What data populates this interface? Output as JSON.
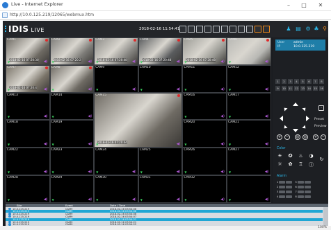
{
  "window": {
    "title": "Live - Internet Explorer",
    "url": "http://10.0.125.219/12065/webmux.htm",
    "minimize": "–",
    "restore": "□",
    "close": "✕"
  },
  "app": {
    "logo": "IDIS",
    "mode": "LIVE",
    "datetime": "2018-02-16 11:54:41"
  },
  "cameras": [
    "CAM1",
    "CAM2",
    "CAM3",
    "CAM4",
    "CAM5",
    "CAM6",
    "CAM7",
    "CAM8",
    "CAM9",
    "CAM10",
    "CAM11",
    "CAM12",
    "CAM13",
    "CAM14",
    "CAM15",
    "CAM16",
    "CAM17",
    "CAM18",
    "CAM19",
    "CAM20",
    "CAM21",
    "CAM22",
    "CAM23",
    "CAM24",
    "CAM25",
    "CAM26",
    "CAM27",
    "CAM28",
    "CAM29",
    "CAM30",
    "CAM31",
    "CAM32"
  ],
  "timestamps": {
    "cam1": "2018-02-16 07:20:30",
    "cam2": "2018-02-16 07:20:2",
    "cam3": "2018-02-16 07:20:48",
    "cam4": "2018-02-16 07:20:48",
    "cam5": "2018-02-16 07:20:48",
    "cam7": "2018-02-16 07:20:4",
    "cam15": "2018-02-16 07:20:44"
  },
  "user": {
    "user_label": "User",
    "user_value": "admin",
    "ip_label": "IP",
    "ip_value": "10.0.125.219"
  },
  "number_buttons": [
    "1",
    "2",
    "3",
    "4",
    "5",
    "6",
    "7",
    "8",
    "9",
    "10",
    "11",
    "12",
    "13",
    "14",
    "15",
    "16"
  ],
  "ptz": {
    "preset_label": "Preset",
    "preview_label": "Preview"
  },
  "color_title": "Color",
  "alarm_title": "Alarm",
  "alarm_rows": [
    "1",
    "2",
    "3",
    "4"
  ],
  "alarm_rows_right": [
    "5",
    "6",
    "7",
    "8"
  ],
  "log": {
    "col_site": "Site",
    "col_event": "Event",
    "col_datetime": "Date / Time",
    "rows": [
      {
        "site": "10.0.125.219",
        "event": "CAM9",
        "time": "2018-02-16 03:54:06"
      },
      {
        "site": "10.0.125.219",
        "event": "CAM9",
        "time": "2018-02-16 03:54:06"
      },
      {
        "site": "10.0.125.219",
        "event": "CAM9",
        "time": "2018-02-16 03:54:06"
      },
      {
        "site": "10.0.125.219",
        "event": "CAM9",
        "time": "2018-02-16 03:54:07"
      },
      {
        "site": "10.0.125.219",
        "event": "CAM9",
        "time": "2018-02-16 03:54:21"
      },
      {
        "site": "10.0.125.219",
        "event": "CAM9",
        "time": "2018-02-16 03:54:21"
      },
      {
        "site": "10.0.125.219",
        "event": "CAM9",
        "time": "2018-02-16 03:54:22"
      }
    ]
  },
  "statusbar": {
    "zoom": "100%"
  },
  "colors": {
    "accent": "#2bb6e6",
    "selected_row": "#1fa6d4",
    "record": "#e02a2a",
    "audio": "#b05ad6"
  }
}
